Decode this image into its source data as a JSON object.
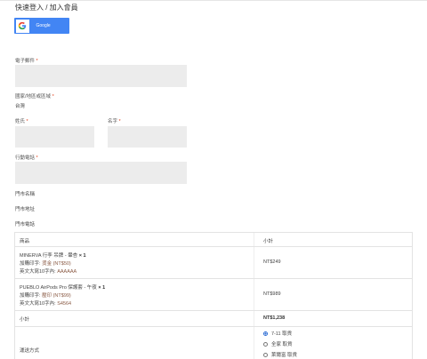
{
  "header": {
    "title": "快速登入 / 加入會員"
  },
  "google_button": {
    "label": "Google"
  },
  "form": {
    "email_label": "電子郵件",
    "country_label": "國家/地區或區域",
    "country_value": "台灣",
    "surname_label": "姓氏",
    "name_label": "名字",
    "phone_label": "行動電話",
    "store_name_label": "門市名稱",
    "store_address_label": "門市地址",
    "store_phone_label": "門市電話",
    "required_mark": "*"
  },
  "order_table": {
    "col_product": "商品",
    "col_subtotal": "小計",
    "items": [
      {
        "name": "MINERVA 行李 吊牌 - 暈杏",
        "qty": "× 1",
        "addon_label": "加購印字:",
        "addon_value": "燙金 (NT$50)",
        "text_label": "英文大寫10字內:",
        "text_value": "AAAAAA",
        "price": "NT$249"
      },
      {
        "name": "PUEBLO AirPods Pro 保護套 - 午夜",
        "qty": "× 1",
        "addon_label": "加購印字:",
        "addon_value": "壓印 (NT$99)",
        "text_label": "英文大寫10字內:",
        "text_value": "S4564",
        "price": "NT$989"
      }
    ],
    "subtotal_label": "小計",
    "subtotal_value": "NT$1,238",
    "shipping_label": "運送方式",
    "shipping_options": [
      "7-11 取貨",
      "全家 取貨",
      "萊爾富 取貨"
    ]
  },
  "colors": {
    "google_blue": "#4285f4",
    "required_red": "#e2401c",
    "input_bg": "#ececec"
  }
}
